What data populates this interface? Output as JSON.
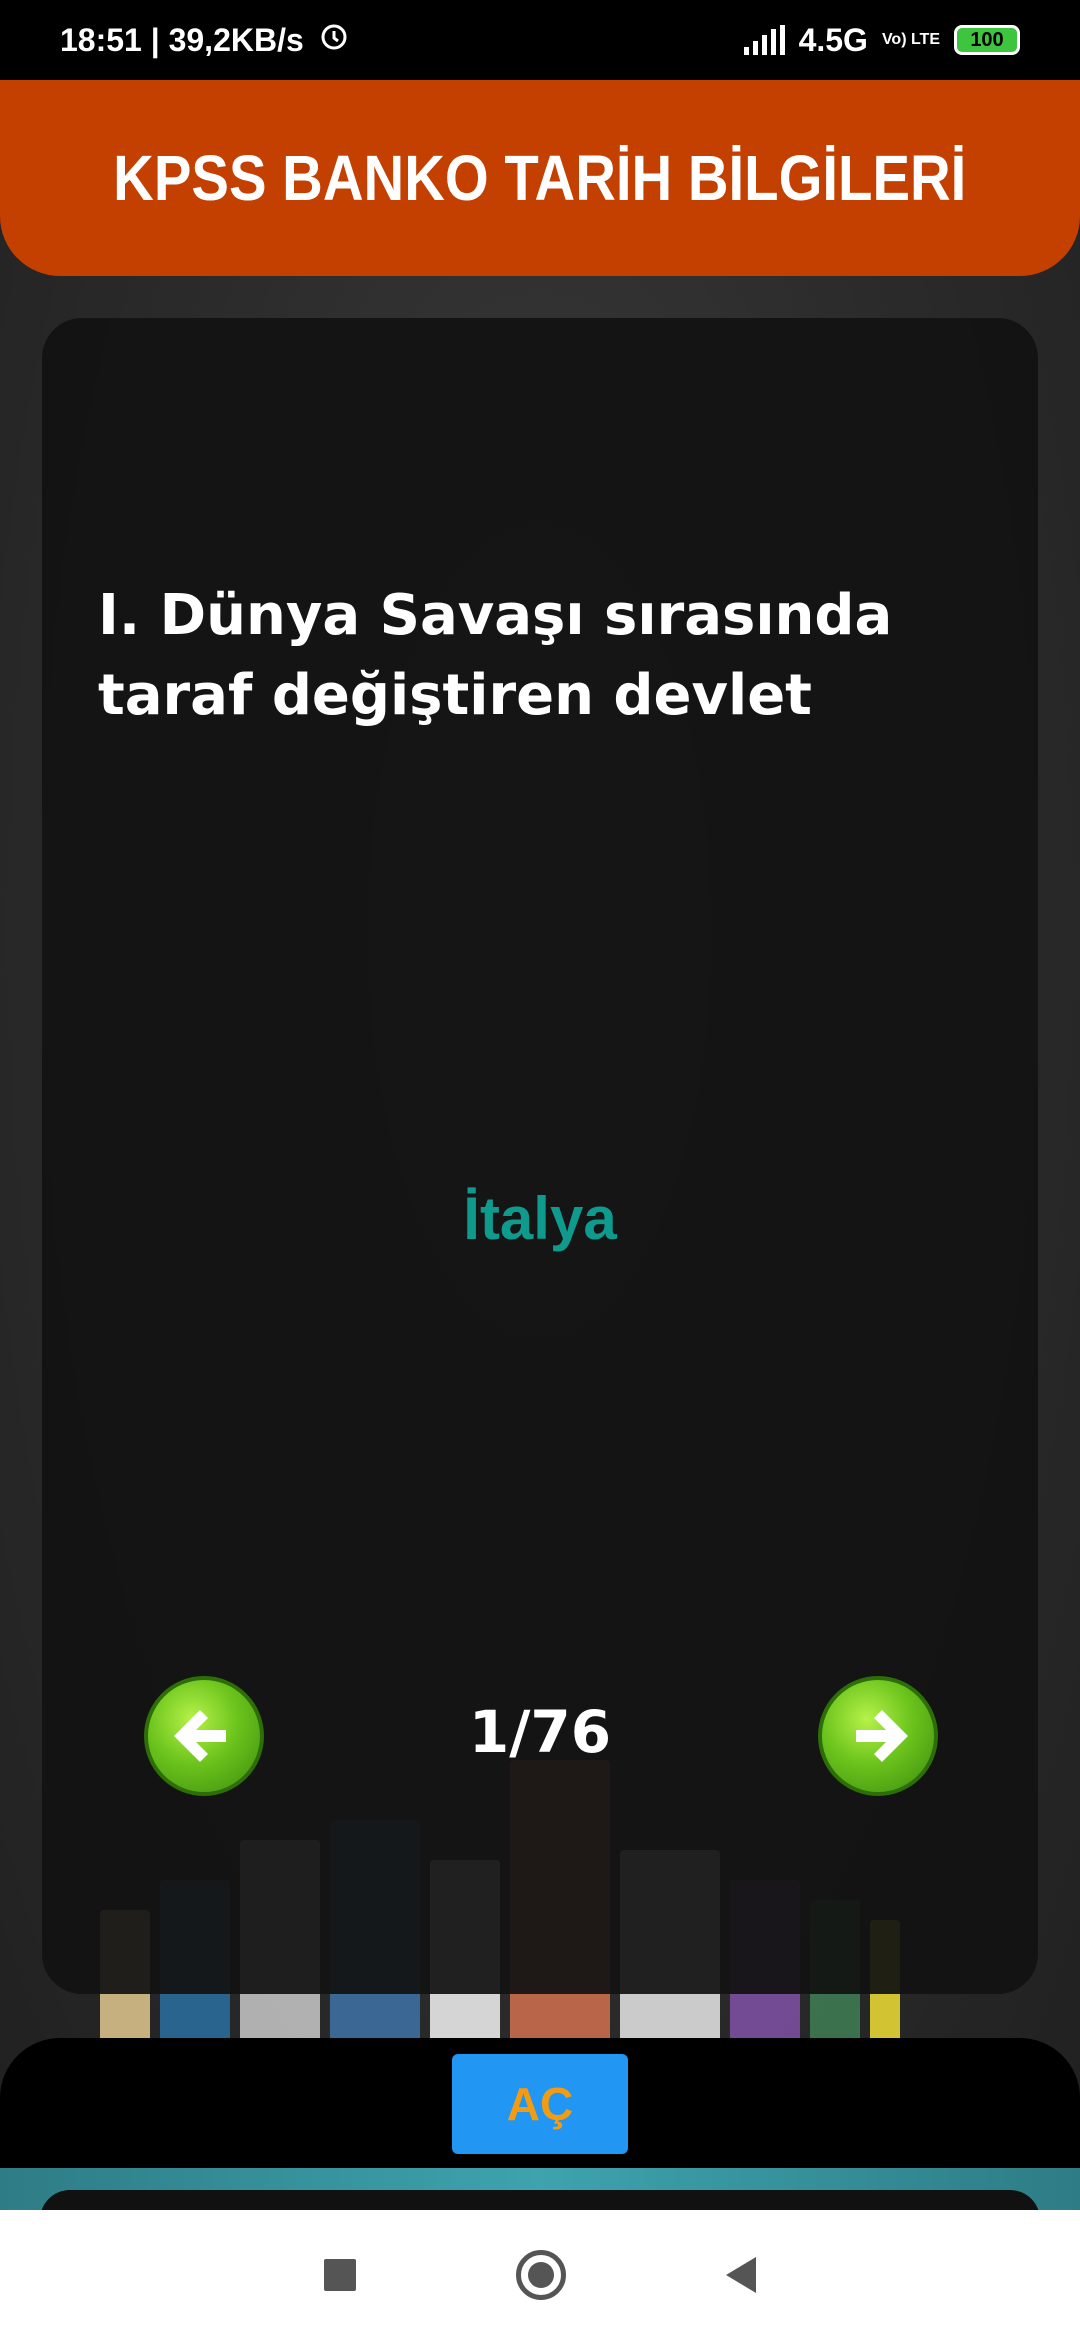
{
  "status_bar": {
    "time_speed": "18:51 | 39,2KB/s",
    "alarm_icon": "alarm-clock-icon",
    "network": "4.5G",
    "volte": "Vo) LTE",
    "battery": "100"
  },
  "header": {
    "title": "KPSS BANKO TARİH BİLGİLERİ"
  },
  "card": {
    "question": "I. Dünya Savaşı sırasında taraf değiştiren devlet",
    "answer": "İtalya",
    "counter": "1/76",
    "prev_icon": "arrow-left-icon",
    "next_icon": "arrow-right-icon"
  },
  "bottom": {
    "open_label": "AÇ"
  },
  "colors": {
    "header": "#c44000",
    "answer": "#0f9a8e",
    "button": "#2196f3",
    "button_text": "#f39c12"
  }
}
